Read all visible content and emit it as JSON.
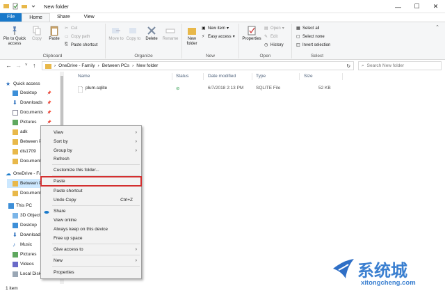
{
  "window": {
    "title": "New folder"
  },
  "tabs": [
    "File",
    "Home",
    "Share",
    "View"
  ],
  "ribbon": {
    "clipboard": {
      "label": "Clipboard",
      "pin_to_quick_access": "Pin to Quick access",
      "copy": "Copy",
      "paste": "Paste",
      "cut": "Cut",
      "copy_path": "Copy path",
      "paste_shortcut": "Paste shortcut"
    },
    "organize": {
      "label": "Organize",
      "move_to": "Move to",
      "copy_to": "Copy to",
      "delete": "Delete",
      "rename": "Rename"
    },
    "new": {
      "label": "New",
      "new_folder": "New folder",
      "new_item": "New item",
      "easy_access": "Easy access"
    },
    "open": {
      "label": "Open",
      "properties": "Properties",
      "open": "Open",
      "edit": "Edit",
      "history": "History"
    },
    "select": {
      "label": "Select",
      "select_all": "Select all",
      "select_none": "Select none",
      "invert_selection": "Invert selection"
    }
  },
  "address": {
    "crumbs": [
      "OneDrive - Family",
      "Between PCs",
      "New folder"
    ],
    "search_placeholder": "Search New folder"
  },
  "nav": [
    {
      "label": "Quick access",
      "icon": "star-icon"
    },
    {
      "label": "Desktop",
      "icon": "desktop-icon",
      "pinned": true
    },
    {
      "label": "Downloads",
      "icon": "download-icon",
      "pinned": true
    },
    {
      "label": "Documents",
      "icon": "document-icon",
      "pinned": true
    },
    {
      "label": "Pictures",
      "icon": "picture-icon",
      "pinned": true
    },
    {
      "label": "adk",
      "icon": "folder-icon"
    },
    {
      "label": "Between PCs",
      "icon": "folder-icon"
    },
    {
      "label": "dis1709",
      "icon": "folder-icon"
    },
    {
      "label": "Documents",
      "icon": "folder-icon"
    },
    {
      "label": "OneDrive - Family",
      "icon": "cloud-icon"
    },
    {
      "label": "Between PCs",
      "icon": "folder-icon",
      "selected": true
    },
    {
      "label": "Documents",
      "icon": "folder-icon"
    },
    {
      "label": "This PC",
      "icon": "computer-icon"
    },
    {
      "label": "3D Objects",
      "icon": "cube-icon"
    },
    {
      "label": "Desktop",
      "icon": "desktop-icon"
    },
    {
      "label": "Downloads",
      "icon": "download-icon"
    },
    {
      "label": "Music",
      "icon": "music-icon"
    },
    {
      "label": "Pictures",
      "icon": "picture-icon"
    },
    {
      "label": "Videos",
      "icon": "video-icon"
    },
    {
      "label": "Local Disk (C:)",
      "icon": "disk-icon"
    }
  ],
  "columns": [
    "Name",
    "Status",
    "Date modified",
    "Type",
    "Size"
  ],
  "files": [
    {
      "name": "plum.sqlite",
      "status": "synced",
      "date": "6/7/2018 2:13 PM",
      "type": "SQLITE File",
      "size": "52 KB"
    }
  ],
  "status_bar": "1 item",
  "context_menu": [
    {
      "label": "View",
      "submenu": true
    },
    {
      "label": "Sort by",
      "submenu": true
    },
    {
      "label": "Group by",
      "submenu": true
    },
    {
      "label": "Refresh"
    },
    {
      "sep": true
    },
    {
      "label": "Customize this folder..."
    },
    {
      "sep": true
    },
    {
      "label": "Paste",
      "highlighted": true
    },
    {
      "label": "Paste shortcut"
    },
    {
      "label": "Undo Copy",
      "shortcut": "Ctrl+Z"
    },
    {
      "sep": true
    },
    {
      "label": "Share",
      "icon": "onedrive-icon"
    },
    {
      "label": "View online"
    },
    {
      "label": "Always keep on this device"
    },
    {
      "label": "Free up space"
    },
    {
      "sep": true
    },
    {
      "label": "Give access to",
      "submenu": true
    },
    {
      "sep": true
    },
    {
      "label": "New",
      "submenu": true
    },
    {
      "sep": true
    },
    {
      "label": "Properties"
    }
  ],
  "watermark": {
    "text": "系统城",
    "url": "xitongcheng.com"
  },
  "colors": {
    "accent": "#1979ca",
    "selection": "#cce8ff",
    "highlight_border": "#d32f2f",
    "folder": "#e8b84a"
  }
}
